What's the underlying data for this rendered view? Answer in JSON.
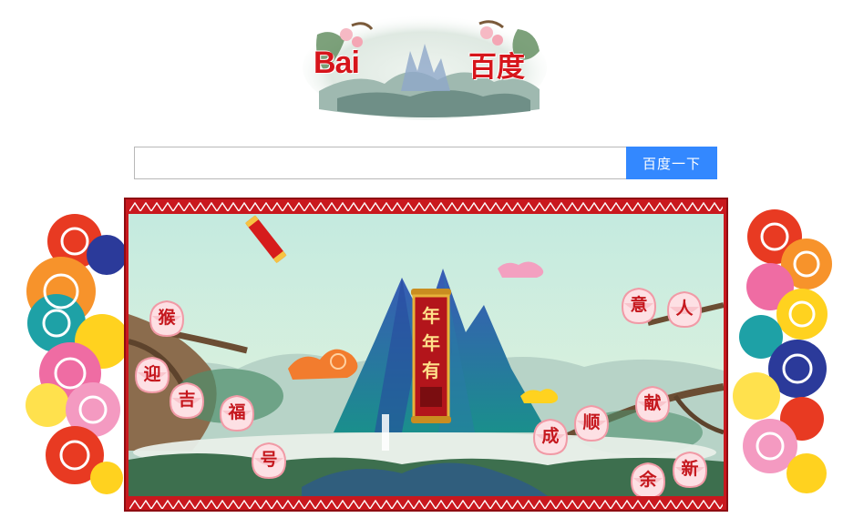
{
  "logo": {
    "latin": "Bai",
    "cjk": "百度"
  },
  "search": {
    "value": "",
    "placeholder": "",
    "button_label": "百度一下"
  },
  "doodle": {
    "scroll_chars": [
      "年",
      "年",
      "有"
    ],
    "peaches": [
      {
        "char": "猴"
      },
      {
        "char": "迎"
      },
      {
        "char": "吉"
      },
      {
        "char": "福"
      },
      {
        "char": "号"
      },
      {
        "char": "意"
      },
      {
        "char": "人"
      },
      {
        "char": "献"
      },
      {
        "char": "顺"
      },
      {
        "char": "成"
      },
      {
        "char": "新"
      },
      {
        "char": "余"
      }
    ]
  },
  "colors": {
    "accent": "#d6151b",
    "button": "#3388ff",
    "frame": "#c9181e",
    "sky": "#bfe6dc"
  }
}
